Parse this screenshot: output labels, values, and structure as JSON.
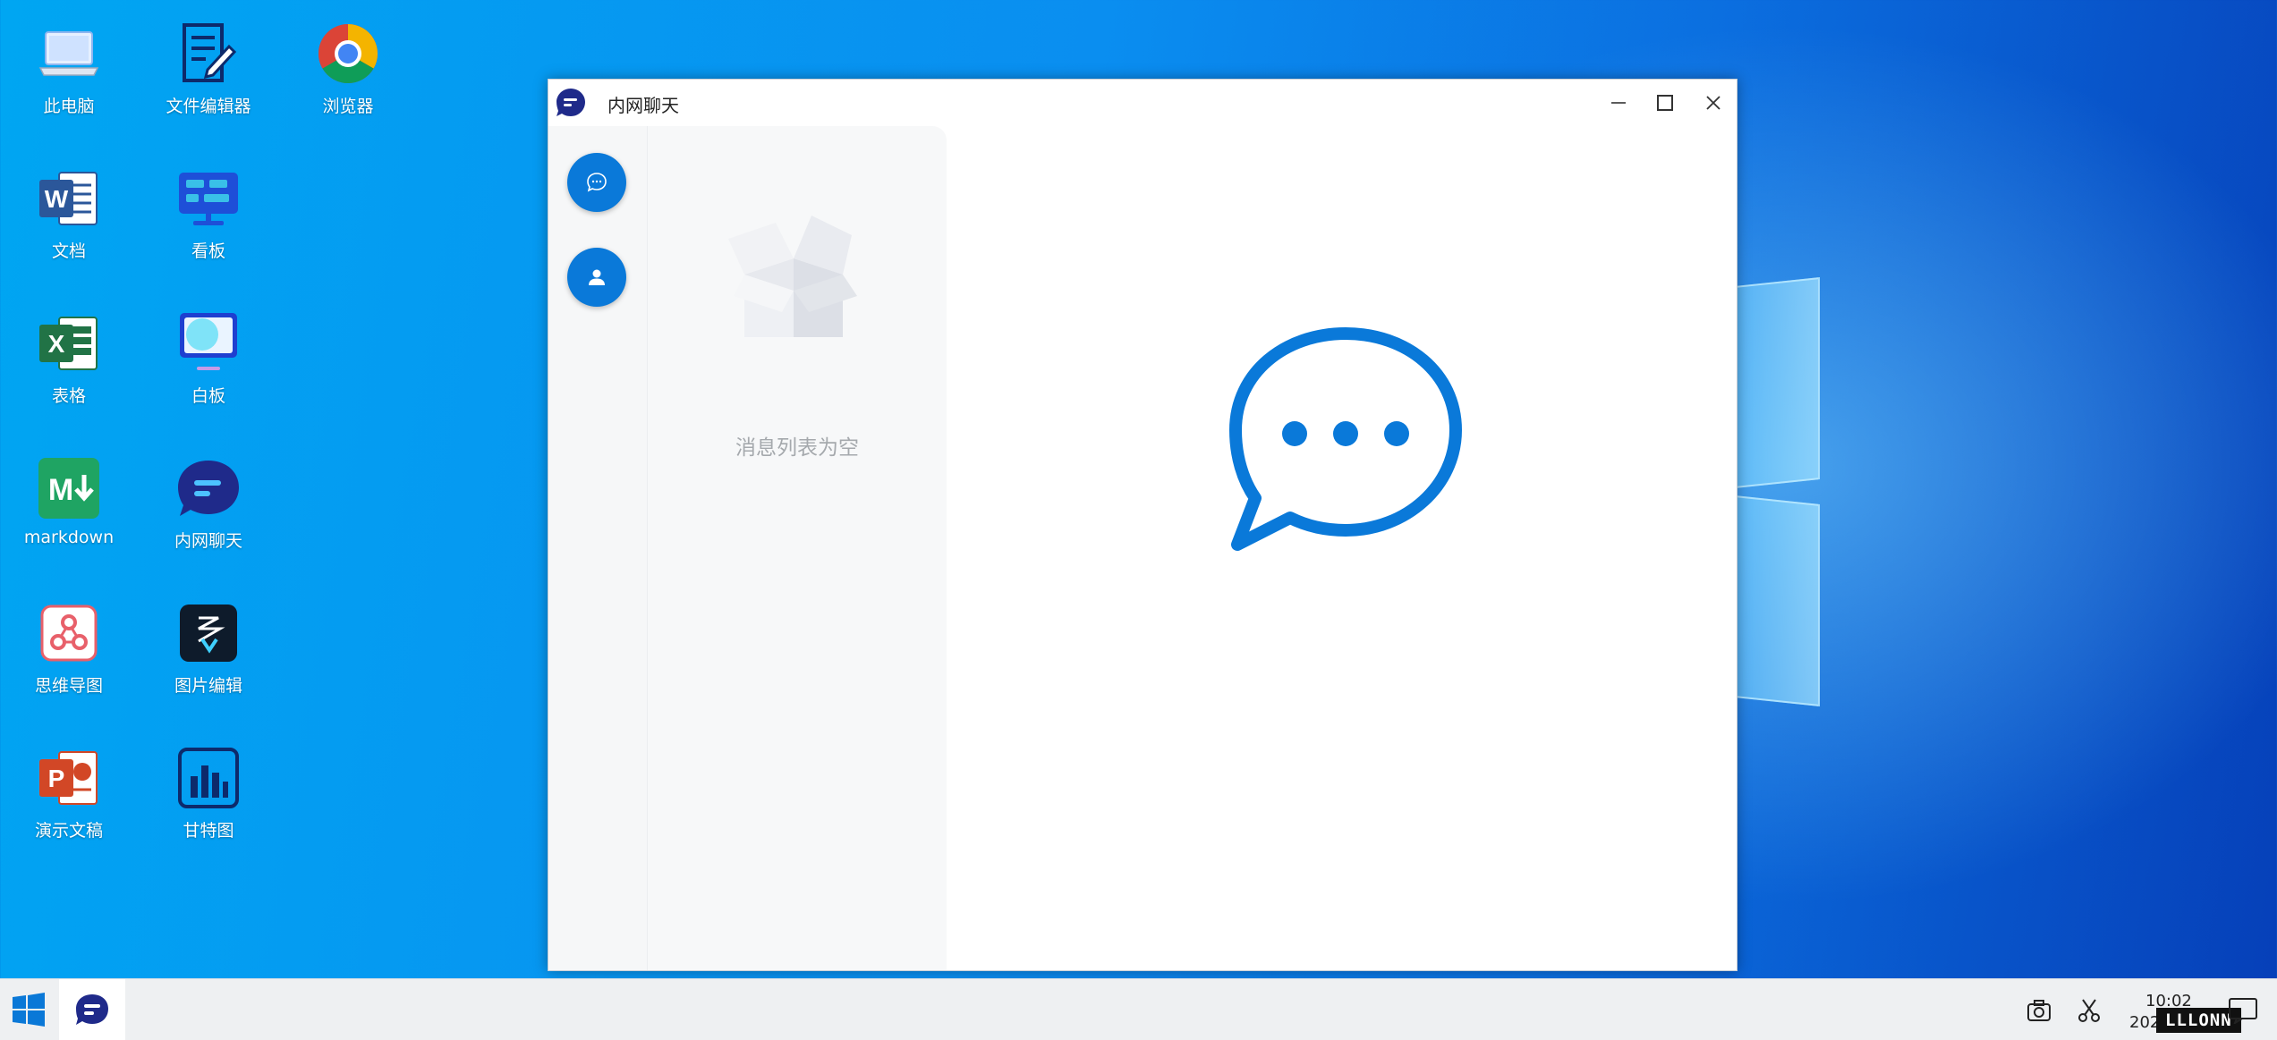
{
  "desktop": {
    "icons": [
      {
        "label": "此电脑"
      },
      {
        "label": "文件编辑器"
      },
      {
        "label": "浏览器"
      },
      {
        "label": "文档"
      },
      {
        "label": "看板"
      },
      {
        "label": "表格"
      },
      {
        "label": "白板"
      },
      {
        "label": "markdown"
      },
      {
        "label": "内网聊天"
      },
      {
        "label": "思维导图"
      },
      {
        "label": "图片编辑"
      },
      {
        "label": "演示文稿"
      },
      {
        "label": "甘特图"
      }
    ]
  },
  "window": {
    "title": "内网聊天",
    "empty_message": "消息列表为空"
  },
  "taskbar": {
    "time": "10:02",
    "date": "202",
    "watermark": "LLLONN"
  },
  "colors": {
    "accent": "#0a79d9",
    "app_logo": "#1f2a8a"
  }
}
